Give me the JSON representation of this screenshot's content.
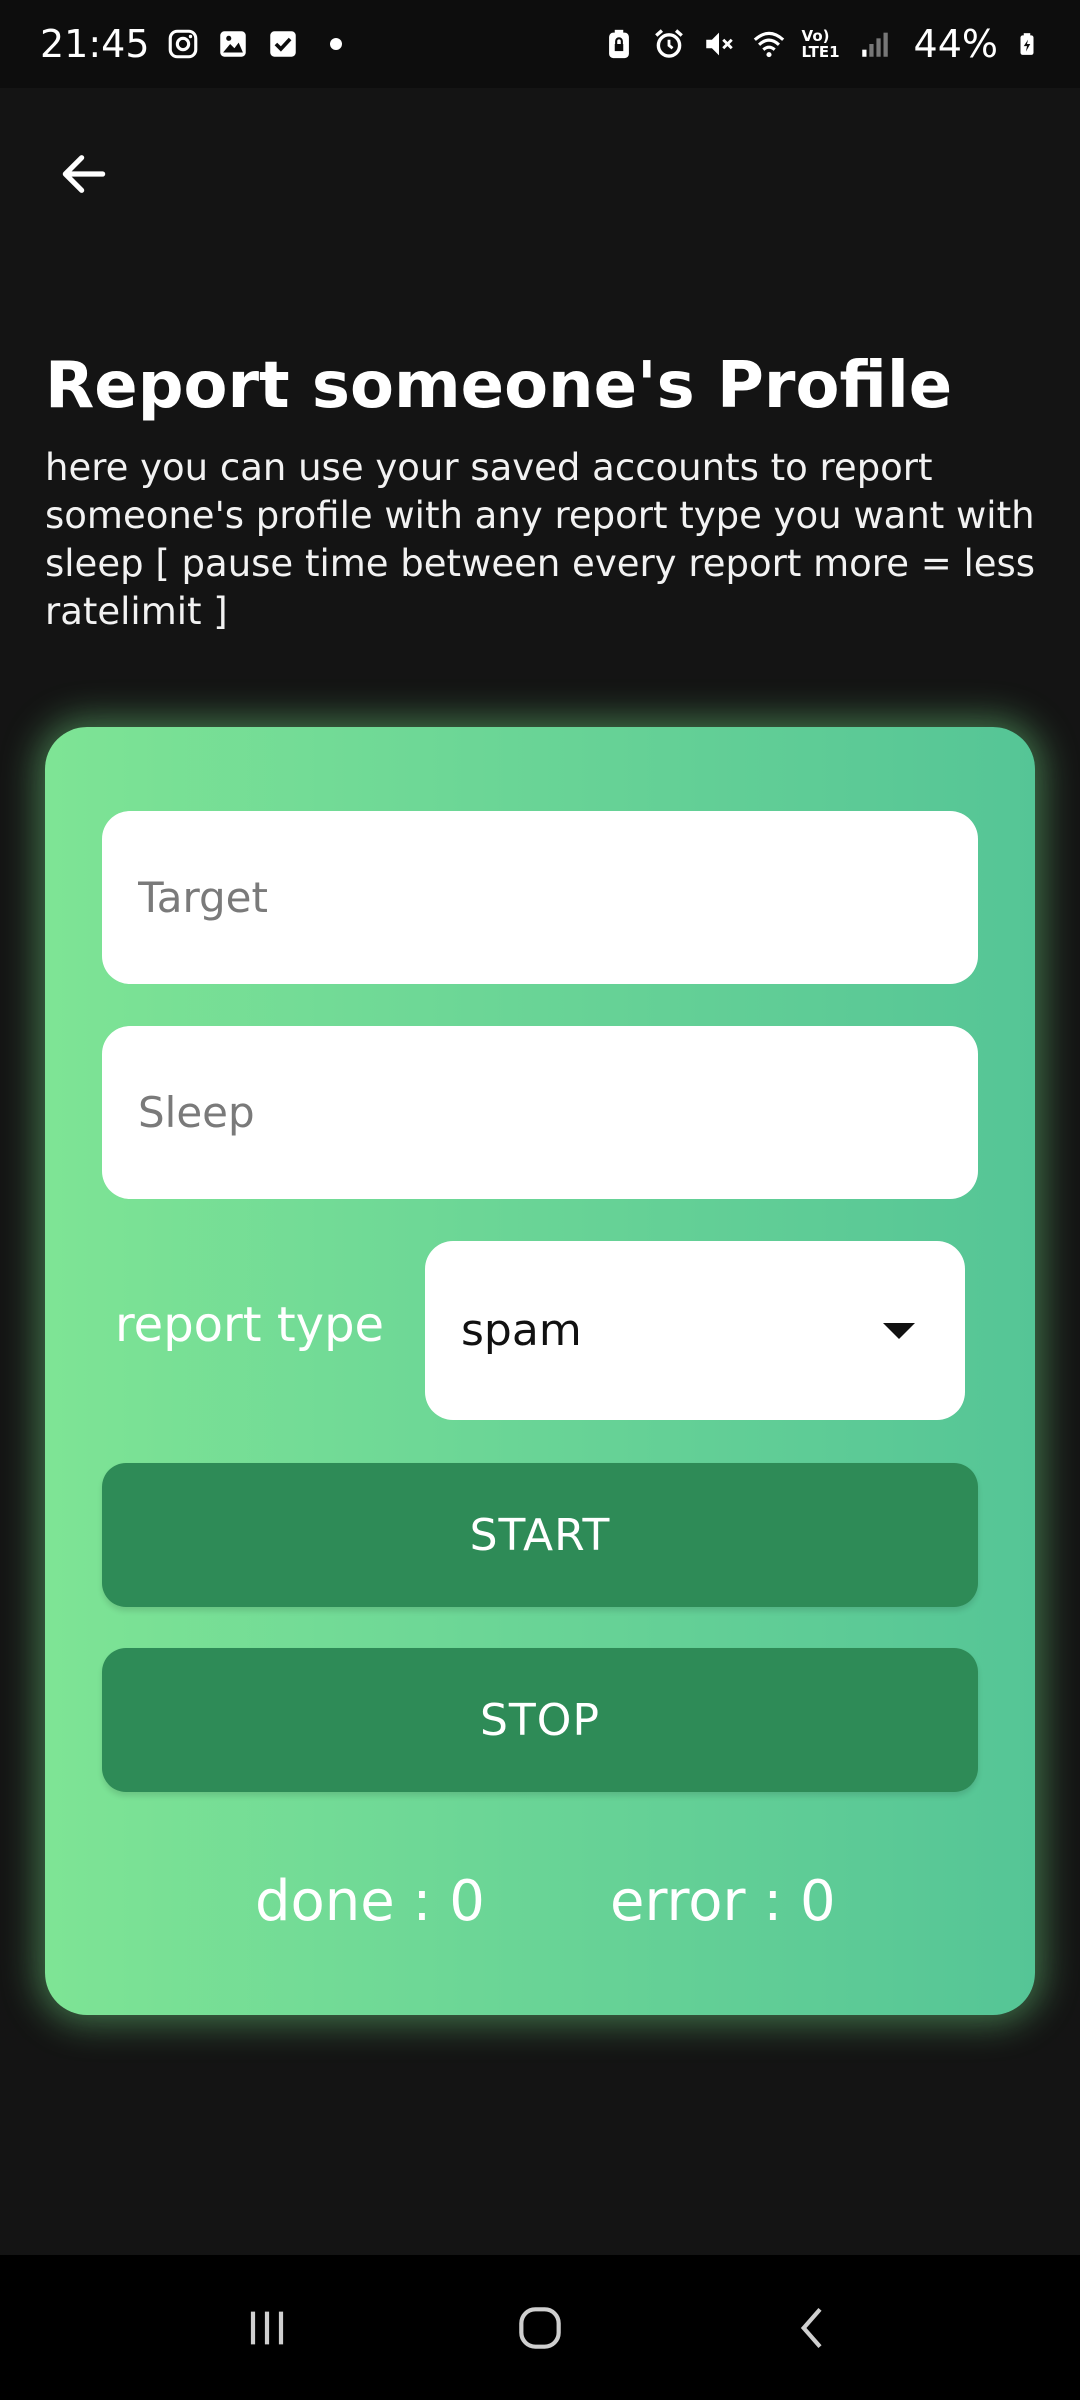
{
  "status_bar": {
    "time": "21:45",
    "battery": "44%",
    "left_icons": [
      "instagram-icon",
      "gallery-icon",
      "checkbox-icon",
      "dot-icon"
    ],
    "right_icons": [
      "lock-battery-icon",
      "alarm-icon",
      "mute-icon",
      "wifi-icon",
      "volte-icon",
      "signal-icon",
      "battery-icon"
    ],
    "volte_text": "Vo) LTE1"
  },
  "header": {
    "back_icon": "arrow-left-icon",
    "title": "Report someone's Profile",
    "description": "here you can use your saved accounts to report someone's profile with any report type you want with sleep [ pause time between every report more = less ratelimit ]"
  },
  "form": {
    "target": {
      "placeholder": "Target",
      "value": ""
    },
    "sleep": {
      "placeholder": "Sleep",
      "value": ""
    },
    "report_type_label": "report type",
    "report_type_value": "spam",
    "start_label": "START",
    "stop_label": "STOP",
    "done_text": "done : 0",
    "error_text": "error : 0"
  },
  "nav_bar": {
    "icons": [
      "recent-apps-icon",
      "home-icon",
      "back-icon"
    ]
  },
  "colors": {
    "background": "#141414",
    "card_gradient_start": "#7ee495",
    "card_gradient_end": "#55c596",
    "button": "#2e8b57"
  }
}
